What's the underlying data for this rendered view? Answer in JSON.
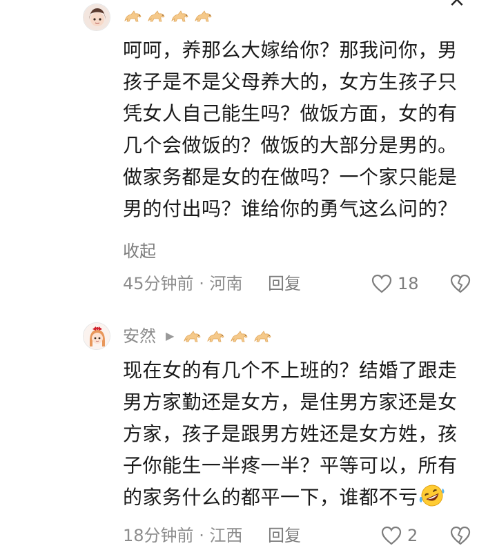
{
  "close_glyph": "×",
  "comments": [
    {
      "username": "",
      "medal_count": 4,
      "lines": [
        "呵呵，养那么大嫁给你？那我问你，男",
        "孩子是不是父母养大的，女方生孩子只",
        "凭女人自己能生吗？做饭方面，女的有",
        "几个会做饭的？做饭的大部分是男的。",
        "做家务都是女的在做吗？一个家只能是",
        "男的付出吗？谁给你的勇气这么问的？"
      ],
      "collapse_label": "收起",
      "time": "45分钟前",
      "separator": "·",
      "location": "河南",
      "reply_label": "回复",
      "likes": "18"
    },
    {
      "username": "安然",
      "arrow": "▶",
      "medal_count": 4,
      "lines": [
        "现在女的有几个不上班的？结婚了跟走",
        "男方家勤还是女方，是住男方家还是女",
        "方家，孩子是跟男方姓还是女方姓，孩",
        "子你能生一半疼一半？平等可以，所有",
        "的家务什么的都平一下，谁都不亏"
      ],
      "emoji": "rofl-emoji",
      "time": "18分钟前",
      "separator": "·",
      "location": "江西",
      "reply_label": "回复",
      "likes": "2"
    }
  ],
  "colors": {
    "text": "#1a1a1a",
    "muted": "#8c8c8c",
    "medal": "#f5c98a"
  }
}
